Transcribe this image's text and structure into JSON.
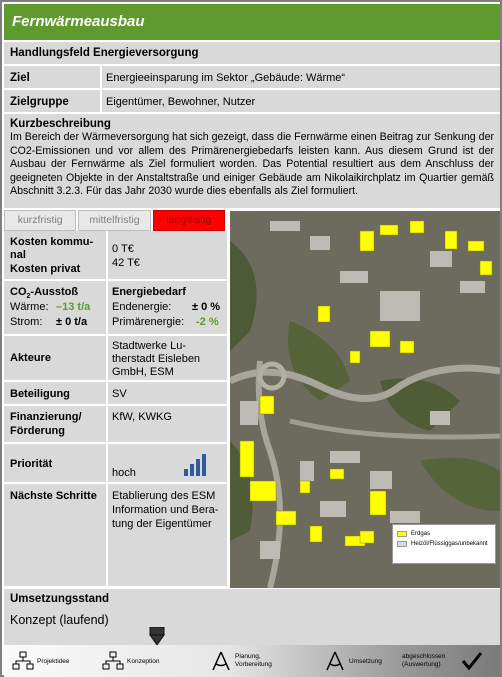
{
  "title": "Fernwärmeausbau",
  "handlungsfeld": "Handlungsfeld Energieversorgung",
  "ziel": {
    "label": "Ziel",
    "value": "Energieeinsparung im Sektor „Gebäude: Wärme“"
  },
  "zielgruppe": {
    "label": "Zielgruppe",
    "value": "Eigentümer, Bewohner, Nutzer"
  },
  "kurzbeschreibung": {
    "label": "Kurzbeschreibung",
    "text": "Im Bereich der Wärmeversorgung hat sich gezeigt, dass die Fernwärme einen Beitrag zur Senkung der CO2-Emissionen und vor allem des Primärenergiebedarfs leisten kann. Aus diesem Grund ist der Ausbau der Fernwärme als Ziel formuliert worden. Das Potential resultiert aus dem Anschluss der geeigneten Objekte in der Anstaltstraße und einiger Gebäude am Nikolaikirchplatz im Quartier gemäß Abschnitt 3.2.3. Für das Jahr 2030 wurde dies ebenfalls als Ziel formuliert."
  },
  "fristen": [
    {
      "label": "kurzfristig",
      "active": false
    },
    {
      "label": "mittelfristig",
      "active": false
    },
    {
      "label": "langfristig",
      "active": true
    }
  ],
  "kosten": {
    "label1": "Kosten kommu-",
    "label2": "nal",
    "label3": "Kosten privat",
    "kommunal": "0 T€",
    "privat": "42 T€"
  },
  "co2": {
    "label": "CO2-Ausstoß",
    "waerme_label": "Wärme:",
    "waerme_value": "–13 t/a",
    "strom_label": "Strom:",
    "strom_value": "± 0 t/a"
  },
  "energiebedarf": {
    "label": "Energiebedarf",
    "end_label": "Endenergie:",
    "end_value": "± 0 %",
    "prim_label": "Primärenergie:",
    "prim_value": "-2 %"
  },
  "akteure": {
    "label": "Akteure",
    "lines": [
      "Stadtwerke Lu-",
      "therstadt Eisleben",
      "GmbH, ESM"
    ]
  },
  "beteiligung": {
    "label": "Beteiligung",
    "value": "SV"
  },
  "finanzierung": {
    "label1": "Finanzierung/",
    "label2": "Förderung",
    "value": "KfW, KWKG"
  },
  "prioritaet": {
    "label": "Priorität",
    "value": "hoch",
    "level": 4
  },
  "naechste_schritte": {
    "label": "Nächste Schritte",
    "lines": [
      "Etablierung des ESM",
      "Information und Bera-",
      "tung der Eigentümer"
    ]
  },
  "map_legend": [
    {
      "label": "Erdgas",
      "color": "#ffff00"
    },
    {
      "label": "Heizöl/Flüssiggas/unbekannt",
      "color": "#d9d9d9"
    }
  ],
  "umsetzungsstand": {
    "label": "Umsetzungsstand",
    "value": "Konzept (laufend)"
  },
  "phases": [
    {
      "label": "Projektidee"
    },
    {
      "label": "Konzeption"
    },
    {
      "label": "Planung, Vorbereitung"
    },
    {
      "label": "Umsetzung"
    },
    {
      "label": "abgeschlossen (Auswertung)"
    }
  ],
  "colors": {
    "header": "#5e9a2e",
    "active_frist": "#ff0000",
    "grey": "#d9d9d9",
    "bars": "#2e5c9a"
  }
}
